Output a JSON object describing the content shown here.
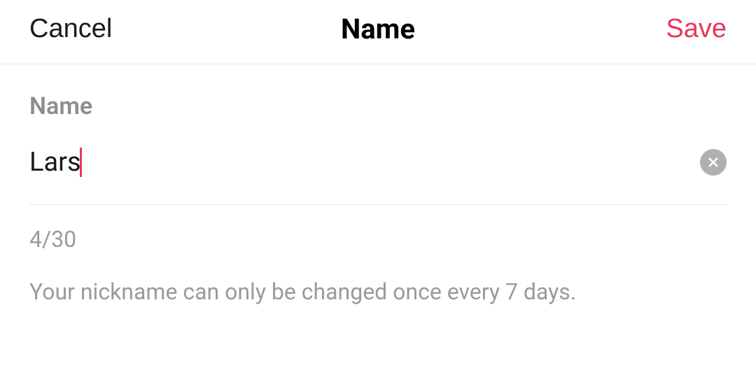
{
  "header": {
    "cancel_label": "Cancel",
    "title": "Name",
    "save_label": "Save"
  },
  "form": {
    "field_label": "Name",
    "value": "Lars",
    "counter": "4/30",
    "hint": "Your nickname can only be changed once every 7 days."
  }
}
